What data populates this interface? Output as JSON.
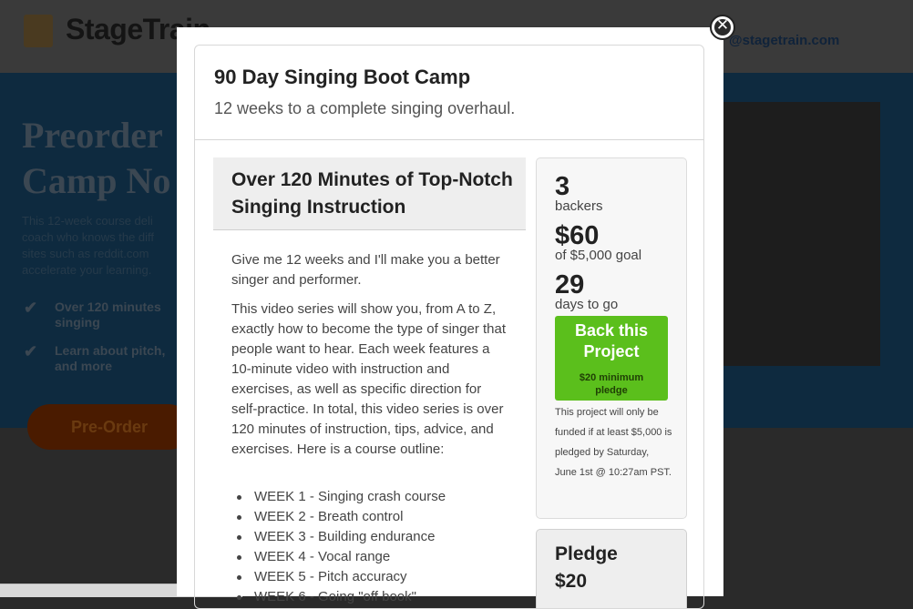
{
  "background": {
    "logo_text": "StageTrain",
    "email_fragment": "@stagetrain.com",
    "hero_title": "Preorder Camp No",
    "hero_description": "This 12-week course deli coach who knows the diff sites such as reddit.com accelerate your learning.",
    "checks": [
      {
        "text": "Over 120 minutes singing"
      },
      {
        "text": "Learn about pitch, and more"
      }
    ],
    "preorder_label": "Pre-Order"
  },
  "modal": {
    "close_symbol": "✕",
    "title": "90 Day Singing Boot Camp",
    "subtitle": "12 weeks to a complete singing overhaul.",
    "content_title": "Over 120 Minutes of Top-Notch Singing Instruction",
    "paragraphs": [
      "Give me 12 weeks and I'll make you a better singer and performer.",
      "This video series will show you, from A to Z, exactly how to become the type of singer that people want to hear. Each week features a 10-minute video with instruction and exercises, as well as specific direction for self-practice. In total, this video series is over 120 minutes of instruction, tips, advice, and exercises. Here is a course outline:"
    ],
    "outline": [
      "WEEK 1 - Singing crash course",
      "WEEK 2 - Breath control",
      "WEEK 3 - Building endurance",
      "WEEK 4 - Vocal range",
      "WEEK 5 - Pitch accuracy",
      "WEEK 6 - Going \"off book\""
    ],
    "stats": {
      "backers_count": "3",
      "backers_label": "backers",
      "pledged_amount": "$60",
      "goal_label": "of $5,000 goal",
      "days_count": "29",
      "days_label": "days to go"
    },
    "back_button": {
      "label": "Back this Project",
      "sub_label": "$20 minimum pledge"
    },
    "funding_note": "This project will only be funded if at least $5,000 is pledged by Saturday, June 1st @ 10:27am PST.",
    "pledge": {
      "label": "Pledge",
      "amount": "$20"
    },
    "colors": {
      "back_button": "#5bbf1c",
      "overlay_dark": "#2a2a2a"
    }
  }
}
